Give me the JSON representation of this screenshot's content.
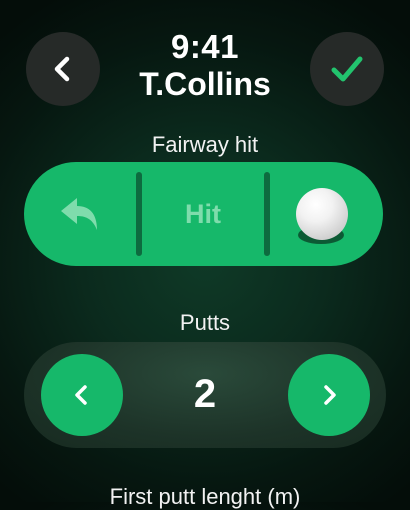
{
  "header": {
    "time": "9:41",
    "player_name": "T.Collins",
    "back_icon": "chevron-left-icon",
    "confirm_icon": "checkmark-icon",
    "confirm_color": "#22c46e"
  },
  "fairway": {
    "label": "Fairway hit",
    "undo_icon": "undo-arrow-icon",
    "status_text": "Hit",
    "ball_icon": "golf-ball-icon",
    "accent_color": "#16b86a"
  },
  "putts": {
    "label": "Putts",
    "value": "2",
    "decrement_icon": "chevron-left-icon",
    "increment_icon": "chevron-right-icon"
  },
  "first_putt": {
    "label": "First putt lenght (m)"
  }
}
